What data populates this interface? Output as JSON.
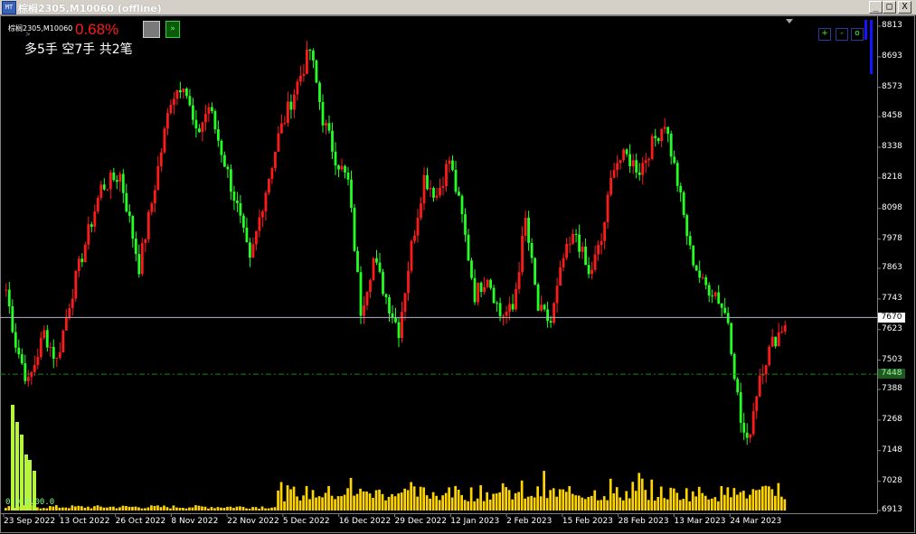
{
  "window": {
    "title": "棕榈2305,M10060 (offline)",
    "min_label": "_",
    "max_label": "□",
    "close_label": "X"
  },
  "overlay": {
    "symbol": "棕榈2305,M10060",
    "sub": ">",
    "percent": "0.68%",
    "positions": "多5手 空7手 共2笔",
    "green_btn": "»",
    "ctrl_plus": "+",
    "ctrl_minus": "-",
    "ctrl_o": "o",
    "zero_label": "0.0_0.00.0"
  },
  "colors": {
    "up": "#ff1a1a",
    "down": "#22ff22",
    "volume": "#ffd400",
    "indicator": "#b6f53a",
    "price_line": "#b4b4c8",
    "dash_line": "#138a13",
    "bar_marker": "#1515ff"
  },
  "chart_data": {
    "type": "candlestick",
    "y_ticks": [
      "8813",
      "8693",
      "8573",
      "8458",
      "8338",
      "8218",
      "8098",
      "7978",
      "7863",
      "7743",
      "7623",
      "7503",
      "7388",
      "7268",
      "7148",
      "7028",
      "6913"
    ],
    "x_ticks": [
      "23 Sep 2022",
      "13 Oct 2022",
      "26 Oct 2022",
      "8 Nov 2022",
      "22 Nov 2022",
      "5 Dec 2022",
      "16 Dec 2022",
      "29 Dec 2022",
      "12 Jan 2023",
      "2 Feb 2023",
      "15 Feb 2023",
      "28 Feb 2023",
      "13 Mar 2023",
      "24 Mar 2023"
    ],
    "current_price": "7670",
    "marked_price": "7448",
    "ylim": [
      6913,
      8813
    ],
    "anchors": [
      [
        0,
        7780
      ],
      [
        3,
        7570
      ],
      [
        7,
        7410
      ],
      [
        12,
        7610
      ],
      [
        16,
        7500
      ],
      [
        20,
        7730
      ],
      [
        25,
        7960
      ],
      [
        30,
        8180
      ],
      [
        36,
        8230
      ],
      [
        42,
        7870
      ],
      [
        46,
        8120
      ],
      [
        52,
        8530
      ],
      [
        56,
        8600
      ],
      [
        60,
        8380
      ],
      [
        64,
        8500
      ],
      [
        69,
        8280
      ],
      [
        73,
        8100
      ],
      [
        77,
        7880
      ],
      [
        81,
        8120
      ],
      [
        86,
        8380
      ],
      [
        92,
        8590
      ],
      [
        96,
        8720
      ],
      [
        100,
        8450
      ],
      [
        104,
        8300
      ],
      [
        108,
        8200
      ],
      [
        112,
        7700
      ],
      [
        116,
        7900
      ],
      [
        120,
        7750
      ],
      [
        124,
        7620
      ],
      [
        128,
        7950
      ],
      [
        132,
        8220
      ],
      [
        136,
        8150
      ],
      [
        140,
        8290
      ],
      [
        144,
        8060
      ],
      [
        148,
        7760
      ],
      [
        152,
        7840
      ],
      [
        156,
        7680
      ],
      [
        160,
        7700
      ],
      [
        164,
        8050
      ],
      [
        168,
        7700
      ],
      [
        172,
        7650
      ],
      [
        176,
        7900
      ],
      [
        180,
        8000
      ],
      [
        184,
        7830
      ],
      [
        188,
        7970
      ],
      [
        192,
        8280
      ],
      [
        196,
        8300
      ],
      [
        200,
        8250
      ],
      [
        204,
        8350
      ],
      [
        208,
        8440
      ],
      [
        212,
        8200
      ],
      [
        216,
        7930
      ],
      [
        220,
        7800
      ],
      [
        224,
        7770
      ],
      [
        228,
        7660
      ],
      [
        232,
        7260
      ],
      [
        234,
        7170
      ],
      [
        238,
        7450
      ],
      [
        242,
        7570
      ],
      [
        246,
        7650
      ]
    ],
    "volume_spike_after": 86
  }
}
